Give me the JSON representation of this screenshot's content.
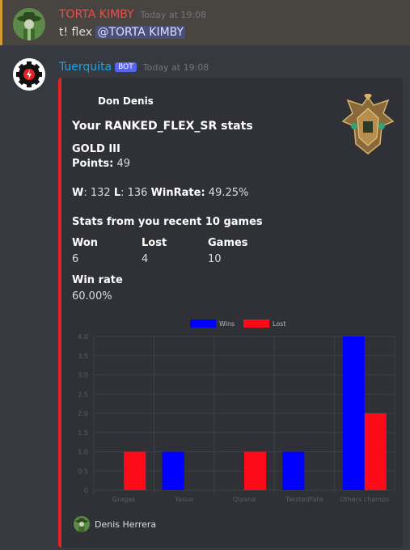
{
  "message1": {
    "username": "TORTA KIMBY",
    "timestamp": "Today at 19:08",
    "text": "t! flex",
    "mention": "@TORTA KIMBY",
    "username_color": "#e84e4e"
  },
  "message2": {
    "username": "Tuerquita",
    "badge": "BOT",
    "timestamp": "Today at 19:08",
    "username_color": "#1ea2e0"
  },
  "embed": {
    "accent_color": "#e52226",
    "author": "Don Denis",
    "title": "Your RANKED_FLEX_SR stats",
    "rank": "GOLD III",
    "points_label": "Points:",
    "points_value": "49",
    "w_label": "W",
    "w_value": ": 132",
    "l_label": "L",
    "l_value": ": 136",
    "winrate_label": "WinRate:",
    "winrate_value": "49.25%",
    "recent_title": "Stats from you recent 10 games",
    "won_label": "Won",
    "won_value": "6",
    "lost_label": "Lost",
    "lost_value": "4",
    "games_label": "Games",
    "games_value": "10",
    "winrate2_label": "Win rate",
    "winrate2_value": "60.00%",
    "thumbnail_icon": "gold-rank-emblem-icon",
    "footer": "Denis Herrera"
  },
  "chart_data": {
    "type": "bar",
    "categories": [
      "Gragas",
      "Yasuo",
      "Qiyana",
      "TwistedFate",
      "Others champs"
    ],
    "series": [
      {
        "name": "Wins",
        "values": [
          0,
          1,
          0,
          1,
          4
        ],
        "color": "#0000ff"
      },
      {
        "name": "Lost",
        "values": [
          1,
          0,
          1,
          0,
          2
        ],
        "color": "#ff0a19"
      }
    ],
    "ylim": [
      0,
      4
    ],
    "yticks": [
      "0",
      "0.5",
      "1.0",
      "1.5",
      "2.0",
      "2.5",
      "3.0",
      "3.5",
      "4.0"
    ],
    "legend": "top",
    "grid": true
  }
}
